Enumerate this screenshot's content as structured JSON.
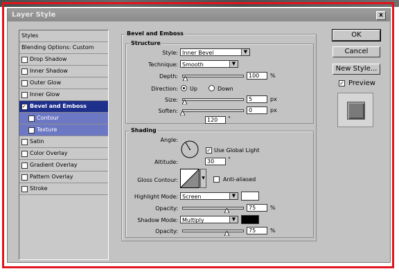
{
  "dialog": {
    "title": "Layer Style",
    "close": "x"
  },
  "styles_list": {
    "header1": "Styles",
    "header2": "Blending Options: Custom",
    "items": [
      {
        "label": "Drop Shadow",
        "checked": false
      },
      {
        "label": "Inner Shadow",
        "checked": false
      },
      {
        "label": "Outer Glow",
        "checked": false
      },
      {
        "label": "Inner Glow",
        "checked": false
      },
      {
        "label": "Bevel and Emboss",
        "checked": true,
        "selected": true
      },
      {
        "label": "Contour",
        "checked": false,
        "sub": true
      },
      {
        "label": "Texture",
        "checked": false,
        "sub": true
      },
      {
        "label": "Satin",
        "checked": false
      },
      {
        "label": "Color Overlay",
        "checked": false
      },
      {
        "label": "Gradient Overlay",
        "checked": false
      },
      {
        "label": "Pattern Overlay",
        "checked": false
      },
      {
        "label": "Stroke",
        "checked": false
      }
    ]
  },
  "bevel": {
    "title": "Bevel and Emboss",
    "structure": {
      "title": "Structure",
      "style_label": "Style:",
      "style_value": "Inner Bevel",
      "technique_label": "Technique:",
      "technique_value": "Smooth",
      "depth_label": "Depth:",
      "depth_value": "100",
      "depth_unit": "%",
      "depth_level": 0.05,
      "direction_label": "Direction:",
      "direction_up": "Up",
      "direction_down": "Down",
      "size_label": "Size:",
      "size_value": "5",
      "size_unit": "px",
      "size_level": 0.04,
      "soften_label": "Soften:",
      "soften_value": "0",
      "soften_unit": "px",
      "soften_level": 0.0
    },
    "shading": {
      "title": "Shading",
      "angle_label": "Angle:",
      "angle_value": "120",
      "angle_unit": "°",
      "global_light_label": "Use Global Light",
      "altitude_label": "Altitude:",
      "altitude_value": "30",
      "altitude_unit": "°",
      "gloss_label": "Gloss Contour:",
      "anti_aliased_label": "Anti-aliased",
      "highlight_label": "Highlight Mode:",
      "highlight_value": "Screen",
      "highlight_color": "#ffffff",
      "hl_opacity_label": "Opacity:",
      "hl_opacity_value": "75",
      "hl_opacity_unit": "%",
      "hl_opacity_level": 0.75,
      "shadow_label": "Shadow Mode:",
      "shadow_value": "Multiply",
      "shadow_color": "#000000",
      "sh_opacity_label": "Opacity:",
      "sh_opacity_value": "75",
      "sh_opacity_unit": "%",
      "sh_opacity_level": 0.75
    }
  },
  "buttons": {
    "ok": "OK",
    "cancel": "Cancel",
    "new_style": "New Style...",
    "preview": "Preview"
  }
}
